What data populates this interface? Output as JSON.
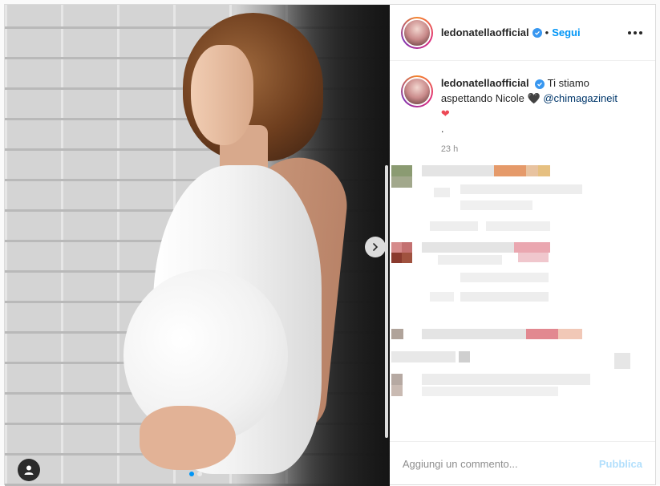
{
  "post": {
    "username": "ledonatella",
    "username_full": "ledonatellaofficial",
    "separator": "•",
    "follow_label": "Segui",
    "caption": {
      "text_1": "Ti stiamo aspettando Nicole",
      "dark_heart": "🖤",
      "mention": "@chimagazineit",
      "red_heart": "❤",
      "dot_line": "."
    },
    "timestamp": "23 h"
  },
  "comment_box": {
    "placeholder": "Aggiungi un commento...",
    "publish_label": "Pubblica"
  },
  "carousel": {
    "slide_count": 2,
    "active_index": 0
  },
  "colors": {
    "accent": "#0095f6",
    "verified": "#3897f0",
    "publish_disabled": "#b2dffc"
  }
}
